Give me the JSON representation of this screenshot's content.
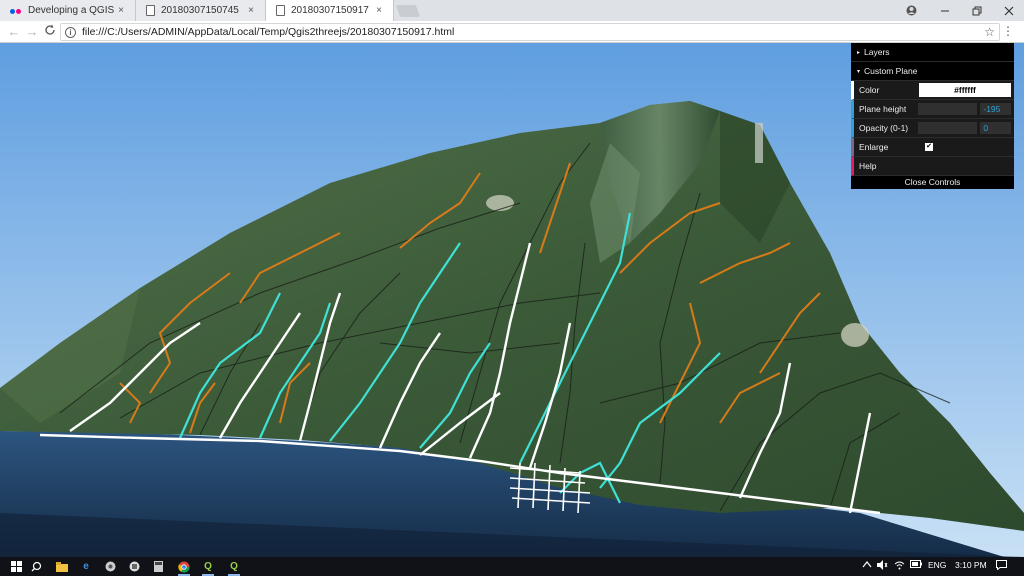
{
  "browser": {
    "tabs": [
      {
        "label": "Developing a QGIS them",
        "favicon": "flickr-dots-icon",
        "active": false
      },
      {
        "label": "20180307150745",
        "favicon": "page-icon",
        "active": false
      },
      {
        "label": "20180307150917",
        "favicon": "page-icon",
        "active": true
      }
    ],
    "close_glyph": "×",
    "url": "file:///C:/Users/ADMIN/AppData/Local/Temp/Qgis2threejs/20180307150917.html"
  },
  "gui": {
    "layers_label": "Layers",
    "custom_plane_label": "Custom Plane",
    "color_label": "Color",
    "color_value": "#ffffff",
    "plane_height_label": "Plane height",
    "plane_height_value": "-195",
    "opacity_label": "Opacity (0-1)",
    "opacity_value": "0",
    "enlarge_label": "Enlarge",
    "enlarge_checked": true,
    "help_label": "Help",
    "close_label": "Close Controls"
  },
  "taskbar": {
    "language": "ENG",
    "time": "3:10 PM"
  },
  "scene_colors": {
    "sky_top": "#5f9ee0",
    "sky_bottom": "#bcd8f2",
    "sea": "#1f3e63",
    "terrain": "#3d5c3a",
    "roads": "#ffffff",
    "rivers": "#3fe0d5",
    "trails": "#d77a1a"
  }
}
